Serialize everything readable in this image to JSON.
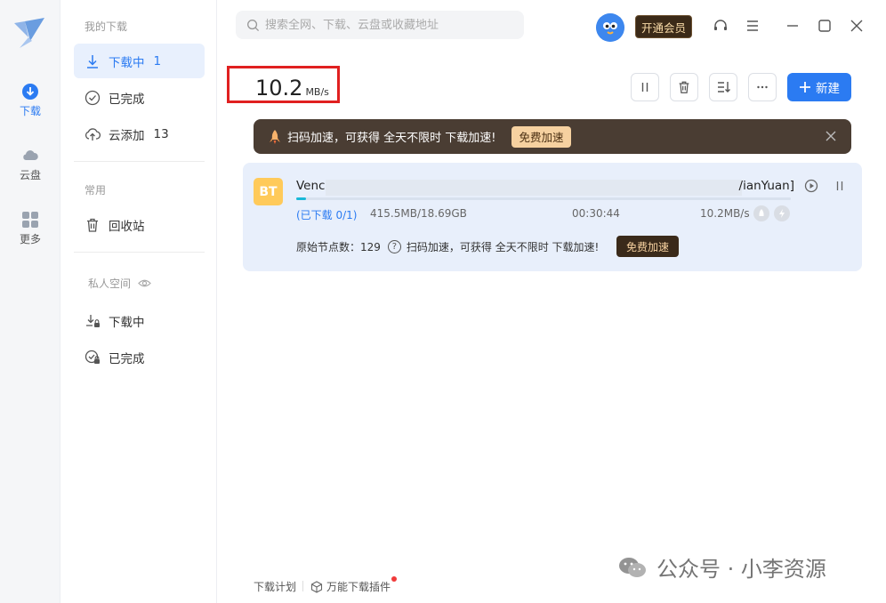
{
  "rail": {
    "items": [
      {
        "label": "下载",
        "icon": "download-circle-icon",
        "active": true
      },
      {
        "label": "云盘",
        "icon": "cloud-icon"
      },
      {
        "label": "更多",
        "icon": "apps-grid-icon"
      }
    ]
  },
  "nav": {
    "section_my": "我的下载",
    "downloading": {
      "label": "下载中",
      "count": "1"
    },
    "completed": {
      "label": "已完成"
    },
    "cloud_added": {
      "label": "云添加",
      "count": "13"
    },
    "section_common": "常用",
    "recycle": {
      "label": "回收站"
    },
    "section_private": "私人空间",
    "private_downloading": {
      "label": "下载中"
    },
    "private_completed": {
      "label": "已完成"
    }
  },
  "header": {
    "search_placeholder": "搜索全网、下载、云盘或收藏地址",
    "vip_label": "开通会员"
  },
  "speed": {
    "value": "10.2",
    "unit": "MB/s"
  },
  "toolbar": {
    "new_label": "新建"
  },
  "banner": {
    "text": "扫码加速，可获得 全天不限时 下载加速!",
    "button": "免费加速"
  },
  "task": {
    "type_badge": "BT",
    "name_start": "Venc",
    "name_end": "/ianYuan]",
    "status": "(已下载 0/1)",
    "size": "415.5MB/18.69GB",
    "remaining": "00:30:44",
    "speed": "10.2MB/s",
    "progress": 0.02,
    "nodes_label": "原始节点数：129",
    "accel_text": "扫码加速，可获得 全天不限时 下载加速!",
    "accel_button": "免费加速"
  },
  "footer": {
    "plan": "下载计划",
    "plugin": "万能下载插件"
  },
  "watermark": {
    "text": "公众号 · 小李资源"
  },
  "colors": {
    "accent": "#2b7bf2",
    "banner_bg": "#4a3d33",
    "highlight_border": "#e02020",
    "task_bg": "#e8effb",
    "progress": "#19b8d8"
  }
}
